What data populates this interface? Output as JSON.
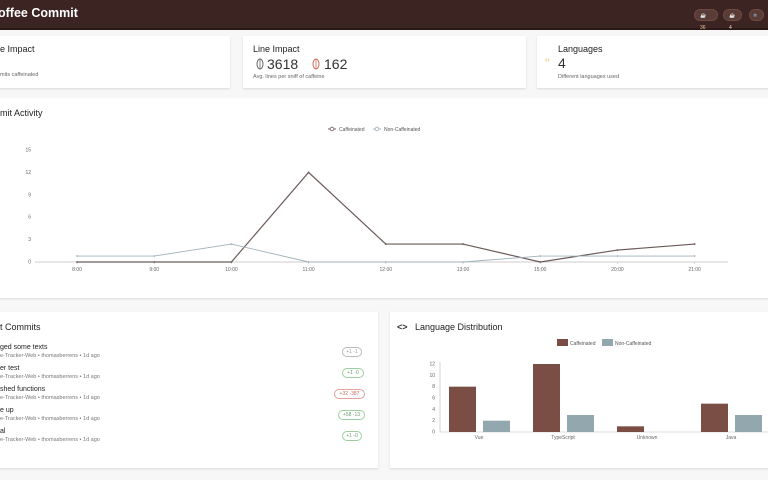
{
  "header": {
    "title": "offee Commit",
    "pill1": "☕ 36",
    "pill2": "☕ 4",
    "pill3": "❄"
  },
  "cards": {
    "caffeine": {
      "title": "e Impact",
      "sub": "mits caffeinated"
    },
    "line": {
      "title": "Line Impact",
      "added": "3618",
      "removed": "162",
      "sub": "Avg. lines per sniff of caffeine"
    },
    "languages": {
      "title": "Languages",
      "value": "4",
      "sub": "Different languages used"
    }
  },
  "activity": {
    "title": "mit Activity"
  },
  "commits": {
    "title": "t Commits",
    "items": [
      {
        "title": "ged some texts",
        "meta": "e-Tracker-Web • thomasberrens • 1d ago",
        "badge": "+1 -1",
        "kind": "muted"
      },
      {
        "title": "er test",
        "meta": "e-Tracker-Web • thomasberrens • 1d ago",
        "badge": "+1 -0",
        "kind": "green"
      },
      {
        "title": "shed functions",
        "meta": "e-Tracker-Web • thomasberrens • 1d ago",
        "badge": "+32 -387",
        "kind": "mixed"
      },
      {
        "title": "e up",
        "meta": "e-Tracker-Web • thomasberrens • 1d ago",
        "badge": "+58 -13",
        "kind": "green"
      },
      {
        "title": "al",
        "meta": "e-Tracker-Web • thomasberrens • 1d ago",
        "badge": "+1 -0",
        "kind": "green"
      }
    ]
  },
  "distribution": {
    "title": "Language Distribution"
  },
  "colors": {
    "caffeinated_line": "#6b5a58",
    "non_caffeinated_line": "#9fb1ba",
    "caffeinated_bar": "#7a4d45",
    "non_caffeinated_bar": "#93a8ae"
  },
  "chart_data": [
    {
      "type": "line",
      "x": [
        "8:00",
        "9:00",
        "10:00",
        "11:00",
        "12:00",
        "13:00",
        "15:00",
        "20:00",
        "21:00"
      ],
      "series": [
        {
          "name": "Caffeinated",
          "values": [
            0,
            0,
            0,
            12,
            2.4,
            2.4,
            0,
            1.6,
            2.4
          ]
        },
        {
          "name": "Non-Caffeinated",
          "values": [
            0.8,
            0.8,
            2.4,
            0,
            0,
            0,
            0.8,
            0.8,
            0.8
          ]
        }
      ],
      "ylim": [
        0,
        12
      ],
      "yticks": [
        "0",
        "3",
        "6",
        "9",
        "12",
        "15"
      ],
      "legend": "top-center"
    },
    {
      "type": "bar",
      "categories": [
        "Vue",
        "TypeScript",
        "Unknown",
        "Java"
      ],
      "series": [
        {
          "name": "Caffeinated",
          "values": [
            8,
            12,
            1,
            5
          ]
        },
        {
          "name": "Non-Caffeinated",
          "values": [
            2,
            3,
            0,
            3
          ]
        }
      ],
      "ylim": [
        0,
        12
      ],
      "yticks": [
        "0",
        "2",
        "4",
        "6",
        "8",
        "10",
        "12"
      ],
      "legend": "top-center"
    }
  ]
}
